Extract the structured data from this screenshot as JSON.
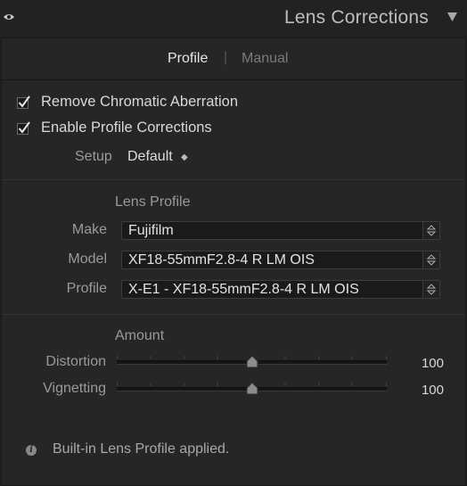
{
  "header": {
    "title": "Lens Corrections",
    "left_icon": "eye-icon",
    "right_icon": "collapse-triangle-icon"
  },
  "tabs": {
    "profile": "Profile",
    "separator": "|",
    "manual": "Manual",
    "active": "Profile"
  },
  "options": {
    "remove_ca": {
      "label": "Remove Chromatic Aberration",
      "checked": true
    },
    "enable_profile": {
      "label": "Enable Profile Corrections",
      "checked": true
    }
  },
  "setup": {
    "label": "Setup",
    "value": "Default",
    "arrows": "◆"
  },
  "lens_profile": {
    "title": "Lens Profile",
    "make": {
      "label": "Make",
      "value": "Fujifilm"
    },
    "model": {
      "label": "Model",
      "value": "XF18-55mmF2.8-4 R LM OIS"
    },
    "profile": {
      "label": "Profile",
      "value": "X-E1 - XF18-55mmF2.8-4 R LM OIS"
    }
  },
  "amount": {
    "title": "Amount",
    "distortion": {
      "label": "Distortion",
      "value": "100",
      "fraction": 0.5
    },
    "vignetting": {
      "label": "Vignetting",
      "value": "100",
      "fraction": 0.5
    }
  },
  "info": {
    "icon": "info-icon",
    "text": "Built-in Lens Profile applied."
  },
  "colors": {
    "background": "#262626",
    "header": "#222222",
    "text": "#d6d6d6",
    "muted": "#9a9a9a"
  }
}
